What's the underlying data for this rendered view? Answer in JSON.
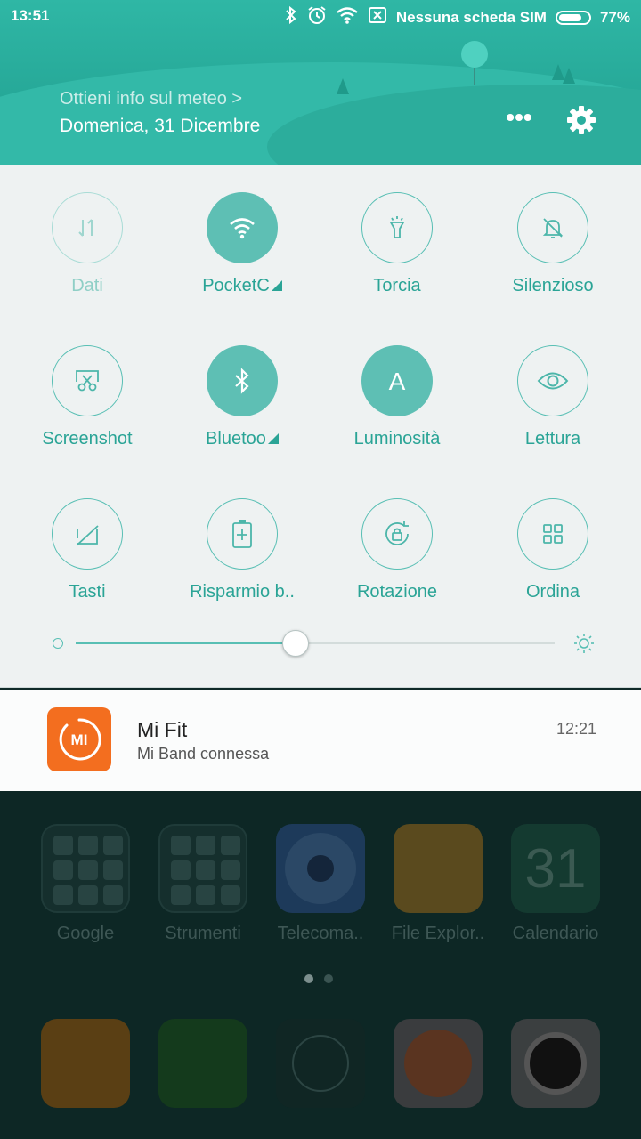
{
  "status_bar": {
    "time": "13:51",
    "carrier": "Nessuna scheda SIM",
    "battery": "77%",
    "battery_level": 0.77,
    "icons": [
      "bluetooth-icon",
      "alarm-icon",
      "wifi-icon",
      "no-sim-icon",
      "battery-icon"
    ]
  },
  "header": {
    "weather_link": "Ottieni info sul meteo >",
    "date": "Domenica, 31 Dicembre",
    "more_label": "•••"
  },
  "quick_settings": {
    "tiles": [
      {
        "label": "Dati",
        "icon": "data-arrows-icon",
        "state": "disabled"
      },
      {
        "label": "PocketC",
        "icon": "wifi-icon",
        "state": "on",
        "expandable": true
      },
      {
        "label": "Torcia",
        "icon": "flashlight-icon",
        "state": "off"
      },
      {
        "label": "Silenzioso",
        "icon": "bell-off-icon",
        "state": "off"
      },
      {
        "label": "Screenshot",
        "icon": "scissors-icon",
        "state": "off"
      },
      {
        "label": "Bluetoo",
        "icon": "bluetooth-icon",
        "state": "on",
        "expandable": true
      },
      {
        "label": "Luminosità",
        "icon": "auto-brightness-icon",
        "state": "on",
        "glyph": "A"
      },
      {
        "label": "Lettura",
        "icon": "eye-icon",
        "state": "off"
      },
      {
        "label": "Tasti",
        "icon": "buttons-off-icon",
        "state": "off"
      },
      {
        "label": "Risparmio b..",
        "icon": "battery-saver-icon",
        "state": "off"
      },
      {
        "label": "Rotazione",
        "icon": "rotation-lock-icon",
        "state": "off"
      },
      {
        "label": "Ordina",
        "icon": "grid-icon",
        "state": "off"
      }
    ],
    "brightness": 0.46
  },
  "notification": {
    "app": "Mi Fit",
    "text": "Mi Band connessa",
    "time": "12:21",
    "icon_text": "MI",
    "color": "#f36e1f"
  },
  "home": {
    "apps": [
      {
        "label": "Google"
      },
      {
        "label": "Strumenti"
      },
      {
        "label": "Telecoma.."
      },
      {
        "label": "File Explor.."
      },
      {
        "label": "Calendario",
        "badge": "31"
      }
    ],
    "page_count": 2,
    "dock": [
      "messages-icon",
      "phone-icon",
      "lock-icon",
      "firefox-icon",
      "camera-icon"
    ]
  },
  "colors": {
    "accent": "#2aa496",
    "header": "#2aae9e"
  }
}
